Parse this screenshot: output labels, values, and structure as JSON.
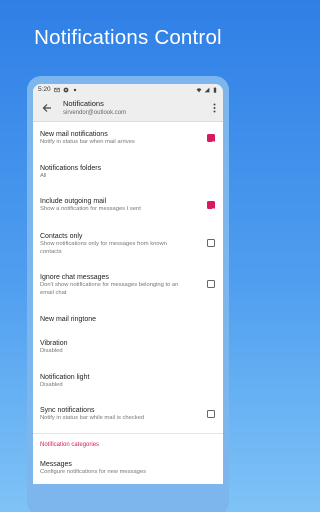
{
  "promo": {
    "title": "Notifications Control"
  },
  "statusbar": {
    "time": "5:20"
  },
  "appbar": {
    "title": "Notifications",
    "subtitle": "sirvendor@outlook.com"
  },
  "settings": [
    {
      "title": "New mail notifications",
      "subtitle": "Notify in status bar when mail arrives",
      "checkbox": true
    },
    {
      "title": "Notifications folders",
      "subtitle": "All"
    },
    {
      "title": "Include outgoing mail",
      "subtitle": "Show a notification for messages I sent",
      "checkbox": true
    },
    {
      "title": "Contacts only",
      "subtitle": "Show notifications only for messages from known contacts",
      "checkbox": false
    },
    {
      "title": "Ignore chat messages",
      "subtitle": "Don't show notifications for messages belonging to an email chat",
      "checkbox": false
    },
    {
      "title": "New mail ringtone"
    },
    {
      "title": "Vibration",
      "subtitle": "Disabled"
    },
    {
      "title": "Notification light",
      "subtitle": "Disabled"
    },
    {
      "title": "Sync notifications",
      "subtitle": "Notify in status bar while mail is checked",
      "checkbox": false
    }
  ],
  "category": {
    "header": "Notification categories"
  },
  "messages": {
    "title": "Messages",
    "subtitle": "Configure notifications for new messages"
  },
  "colors": {
    "accent": "#d81b60",
    "background_top": "#2f7fe6",
    "background_bottom": "#7fc3f6"
  }
}
